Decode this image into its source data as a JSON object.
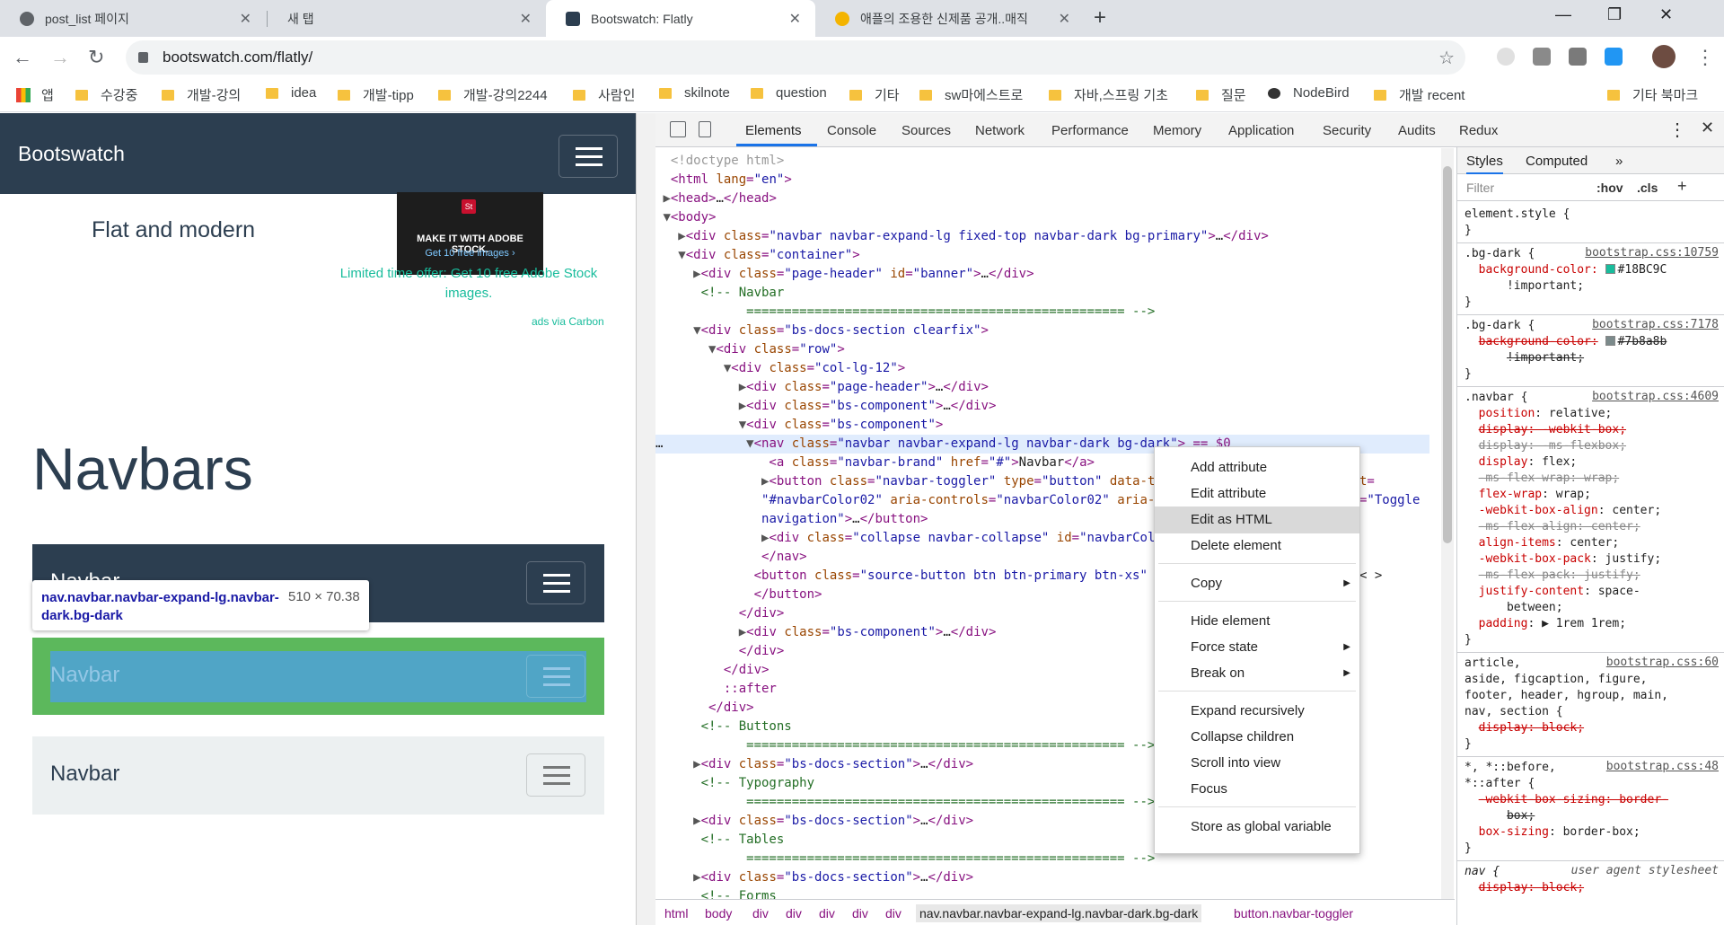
{
  "tabs": [
    {
      "title": "post_list 페이지",
      "active": false
    },
    {
      "title": "새 탭",
      "active": false
    },
    {
      "title": "Bootswatch: Flatly",
      "active": true
    },
    {
      "title": "애플의 조용한 신제품 공개..매직",
      "active": false
    }
  ],
  "address": {
    "url": "bootswatch.com/flatly/"
  },
  "bookmarks": [
    "앱",
    "수강중",
    "개발-강의",
    "idea",
    "개발-tipp",
    "개발-강의2244",
    "사람인",
    "skilnote",
    "question",
    "기타",
    "sw마에스트로",
    "자바,스프링 기초",
    "질문",
    "NodeBird",
    "개발 recent",
    "기타 북마크"
  ],
  "page": {
    "brand": "Bootswatch",
    "subtitle": "Flat and modern",
    "ad_line1": "MAKE IT WITH ADOBE STOCK.",
    "ad_line2": "Get 10 free images ›",
    "ad_logo": "St",
    "offer": "Limited time offer: Get 10 free Adobe Stock images.",
    "ads_via": "ads via Carbon",
    "section_title": "Navbars",
    "navbar_label_1": "Navbar",
    "navbar_label_2": "Navbar",
    "navbar_label_3": "Navbar",
    "tooltip_selector": "nav.navbar.navbar-expand-lg.navbar-dark.bg-dark",
    "tooltip_size": "510 × 70.38"
  },
  "devtools": {
    "tabs": [
      "Elements",
      "Console",
      "Sources",
      "Network",
      "Performance",
      "Memory",
      "Application",
      "Security",
      "Audits",
      "Redux"
    ],
    "breadcrumbs": [
      "html",
      "body",
      "div",
      "div",
      "div",
      "div",
      "div",
      "nav.navbar.navbar-expand-lg.navbar-dark.bg-dark",
      "button.navbar-toggler"
    ],
    "styles_tabs": [
      "Styles",
      "Computed"
    ],
    "filter_placeholder": "Filter",
    "hov": ":hov",
    "cls": ".cls"
  },
  "context_menu": [
    {
      "label": "Add attribute",
      "submenu": false
    },
    {
      "label": "Edit attribute",
      "submenu": false
    },
    {
      "label": "Edit as HTML",
      "submenu": false,
      "hover": true
    },
    {
      "label": "Delete element",
      "submenu": false
    },
    {
      "label": "Copy",
      "submenu": true
    },
    {
      "label": "Hide element",
      "submenu": false
    },
    {
      "label": "Force state",
      "submenu": true
    },
    {
      "label": "Break on",
      "submenu": true
    },
    {
      "label": "Expand recursively",
      "submenu": false
    },
    {
      "label": "Collapse children",
      "submenu": false
    },
    {
      "label": "Scroll into view",
      "submenu": false
    },
    {
      "label": "Focus",
      "submenu": false
    },
    {
      "label": "Store as global variable",
      "submenu": false
    }
  ],
  "styles_text": {
    "element_style": "element.style {",
    "bg_dark_1": ".bg-dark {",
    "bg_dark_1_link": "bootstrap.css:10759",
    "bg_dark_1_prop": "background-color:",
    "bg_dark_1_val": "#18BC9C",
    "important": "!important;",
    "bg_dark_2": ".bg-dark {",
    "bg_dark_2_link": "bootstrap.css:7178",
    "bg_dark_2_prop": "background-color:",
    "bg_dark_2_val": "#7b8a8b",
    "navbar": ".navbar {",
    "navbar_link": "bootstrap.css:4609",
    "article_link": "bootstrap.css:60",
    "star_link": "bootstrap.css:48",
    "ua": "user agent stylesheet"
  },
  "colors": {
    "primary_nav": "#2c3e50",
    "success": "#18bc9c",
    "light": "#ecf0f1"
  }
}
